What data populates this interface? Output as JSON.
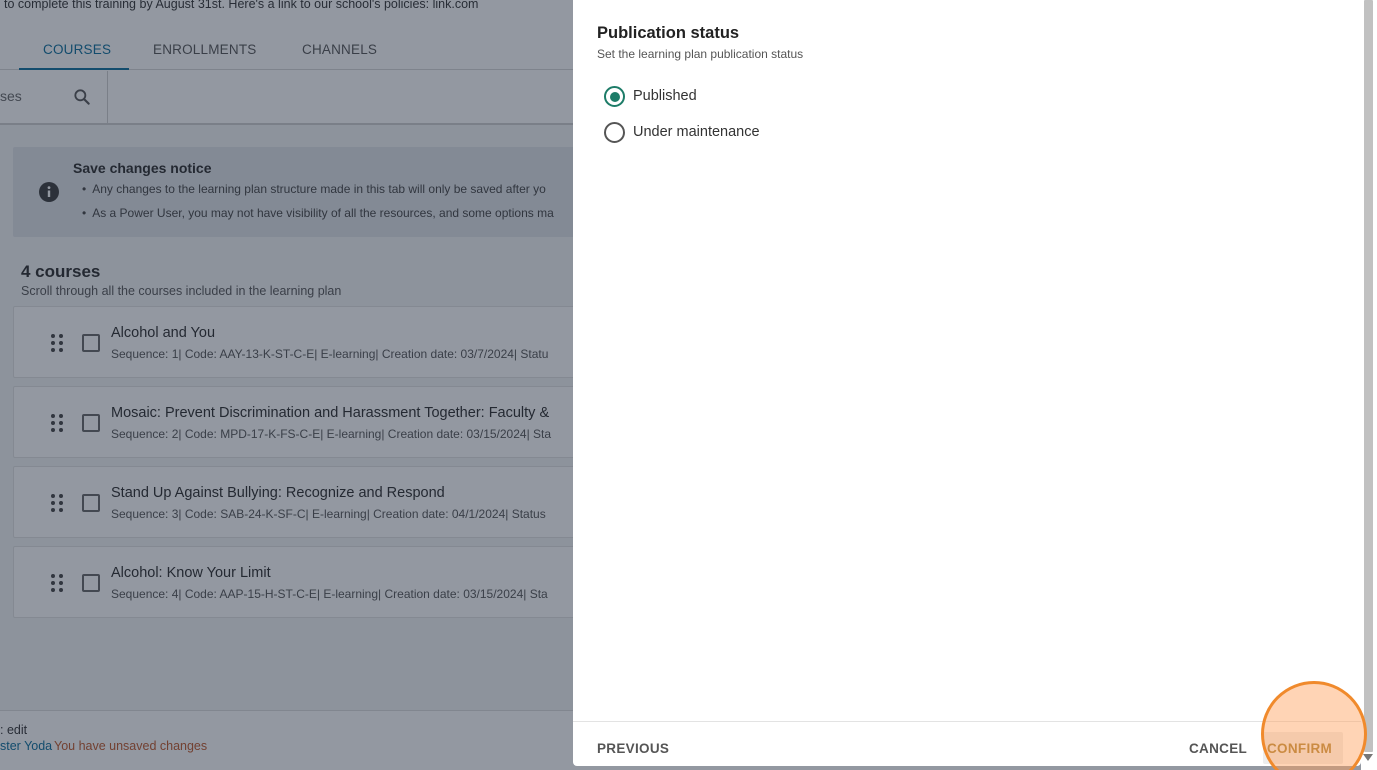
{
  "background": {
    "top_text": "to complete this training by August 31st.  Here's a link to our school's policies: link.com",
    "tabs": [
      {
        "label": "COURSES",
        "active": true
      },
      {
        "label": "ENROLLMENTS",
        "active": false
      },
      {
        "label": "CHANNELS",
        "active": false
      }
    ],
    "search": {
      "placeholder_fragment": "ses",
      "icon": "search-icon"
    },
    "notice": {
      "icon": "info-icon",
      "title": "Save changes notice",
      "bullets": [
        "Any changes to the learning plan structure made in this tab will only be saved after yo",
        "As a Power User, you may not have visibility of all the resources, and some options ma"
      ]
    },
    "courses_header": {
      "count_title": "4 courses",
      "subtitle": "Scroll through all the courses included in the learning plan"
    },
    "courses": [
      {
        "title": "Alcohol and You",
        "meta": "Sequence: 1| Code: AAY-13-K-ST-C-E| E-learning| Creation date: 03/7/2024| Statu"
      },
      {
        "title": "Mosaic: Prevent Discrimination and Harassment Together: Faculty &",
        "meta": "Sequence: 2| Code: MPD-17-K-FS-C-E| E-learning| Creation date: 03/15/2024| Sta"
      },
      {
        "title": "Stand Up Against Bullying: Recognize and Respond",
        "meta": "Sequence: 3| Code: SAB-24-K-SF-C| E-learning| Creation date: 04/1/2024| Status"
      },
      {
        "title": "Alcohol: Know Your Limit",
        "meta": "Sequence: 4| Code: AAP-15-H-ST-C-E| E-learning| Creation date: 03/15/2024| Sta"
      }
    ],
    "footer": {
      "edit_text": ": edit",
      "user_text": "ster Yoda",
      "unsaved_text": "You have unsaved changes"
    }
  },
  "panel": {
    "title": "Publication status",
    "subtitle": "Set the learning plan publication status",
    "options": [
      {
        "label": "Published",
        "checked": true
      },
      {
        "label": "Under maintenance",
        "checked": false
      }
    ],
    "buttons": {
      "previous": "PREVIOUS",
      "cancel": "CANCEL",
      "confirm": "CONFIRM"
    }
  },
  "colors": {
    "accent_blue": "#0a6d9b",
    "radio_green": "#1d7c68",
    "unsaved_orange": "#c0582a",
    "click_highlight": "#f08a2c"
  }
}
